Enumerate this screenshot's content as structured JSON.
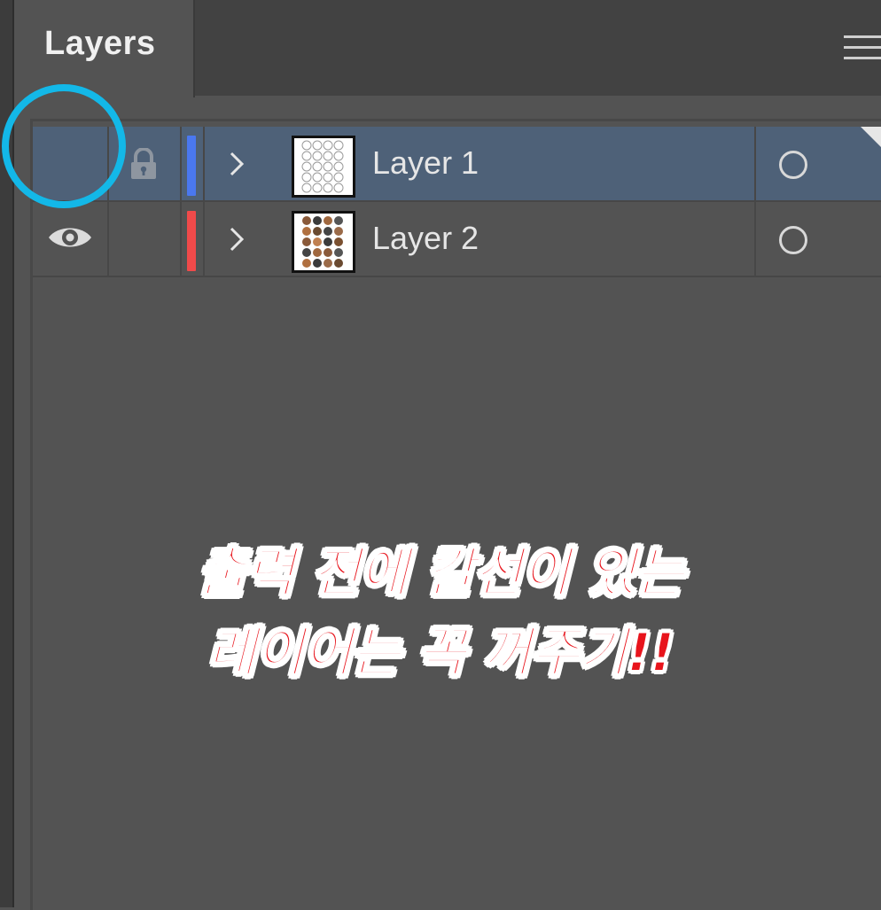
{
  "panel": {
    "tab_label": "Layers",
    "menu_icon": "hamburger-menu-icon"
  },
  "layers": [
    {
      "name": "Layer 1",
      "color": "#4a78f0",
      "visible": false,
      "locked": true,
      "selected": true,
      "thumbnail": "grid-of-empty-circles"
    },
    {
      "name": "Layer 2",
      "color": "#f04a4a",
      "visible": true,
      "locked": false,
      "selected": false,
      "thumbnail": "grid-of-stickers"
    }
  ],
  "annotation": {
    "line1": "출력 전에 칼선이 있는",
    "line2": "레이어는  꼭 꺼주기!!",
    "ring_color": "#13b8e8",
    "text_color": "#e8141c"
  }
}
